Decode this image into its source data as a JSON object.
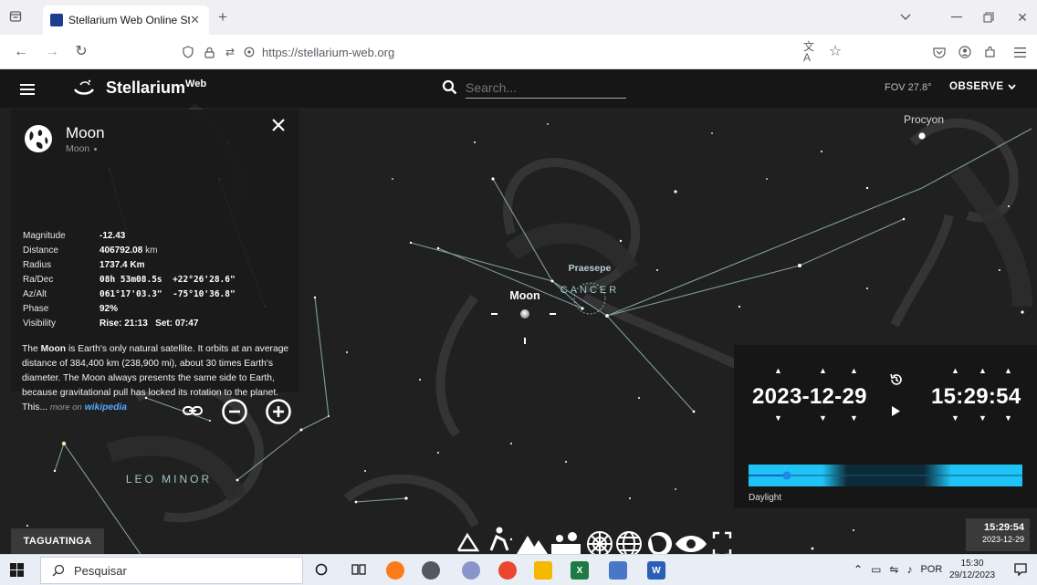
{
  "browser": {
    "tab_title": "Stellarium Web Online Star Map",
    "url": "https://stellarium-web.org"
  },
  "header": {
    "logo_main": "Stellarium",
    "logo_sup": "Web",
    "search_placeholder": "Search...",
    "fov": "FOV 27.8°",
    "observe": "OBSERVE"
  },
  "info": {
    "title": "Moon",
    "subtitle": "Moon",
    "rows": [
      {
        "label": "Magnitude",
        "value": "-12.43"
      },
      {
        "label": "Distance",
        "value": "406792.08",
        "unit": "km"
      },
      {
        "label": "Radius",
        "value": "1737.4 Km"
      },
      {
        "label": "Ra/Dec",
        "value": "08h 53m08.5s  +22°26'28.6\""
      },
      {
        "label": "Az/Alt",
        "value": "061°17'03.3\"  -75°10'36.8\""
      },
      {
        "label": "Phase",
        "value": "92%"
      },
      {
        "label": "Visibility",
        "value": "Rise: 21:13   Set: 07:47"
      }
    ],
    "desc_name": "Moon",
    "desc_pre": "The",
    "desc_text": "is Earth's only natural satellite. It orbits at an average distance of 384,400 km (238,900 mi), about 30 times Earth's diameter. The Moon always presents the same side to Earth, because gravitational pull has locked its rotation to the planet. This...",
    "more_on": "more on",
    "more_link": "wikipedia"
  },
  "sky_labels": {
    "procyon": "Procyon",
    "praesepe": "Praesepe",
    "cancer": "CANCER",
    "moon": "Moon",
    "leo_minor": "LEO MINOR"
  },
  "datetime": {
    "date": "2023-12-29",
    "time": "15:29:54",
    "daylight": "Daylight",
    "slider_position": 0.14
  },
  "location": "TAGUATINGA",
  "bottom_clock": {
    "time": "15:29:54",
    "date": "2023-12-29"
  },
  "taskbar": {
    "search": "Pesquisar",
    "lang": "POR",
    "time": "15:30",
    "date": "29/12/2023"
  },
  "colors": {
    "app_bg": "#202020",
    "accent": "#1fc3f5",
    "link": "#56a9ff",
    "constellation_line": "#9fc7c9"
  }
}
